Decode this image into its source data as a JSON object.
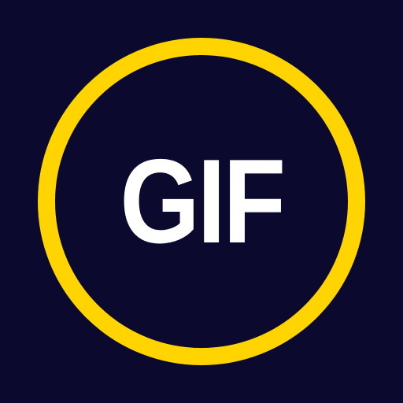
{
  "icon": {
    "name": "gif-icon",
    "text": "GIF",
    "colors": {
      "background": "#0b0a2e",
      "ring": "#ffd400",
      "text": "#ffffff"
    }
  }
}
